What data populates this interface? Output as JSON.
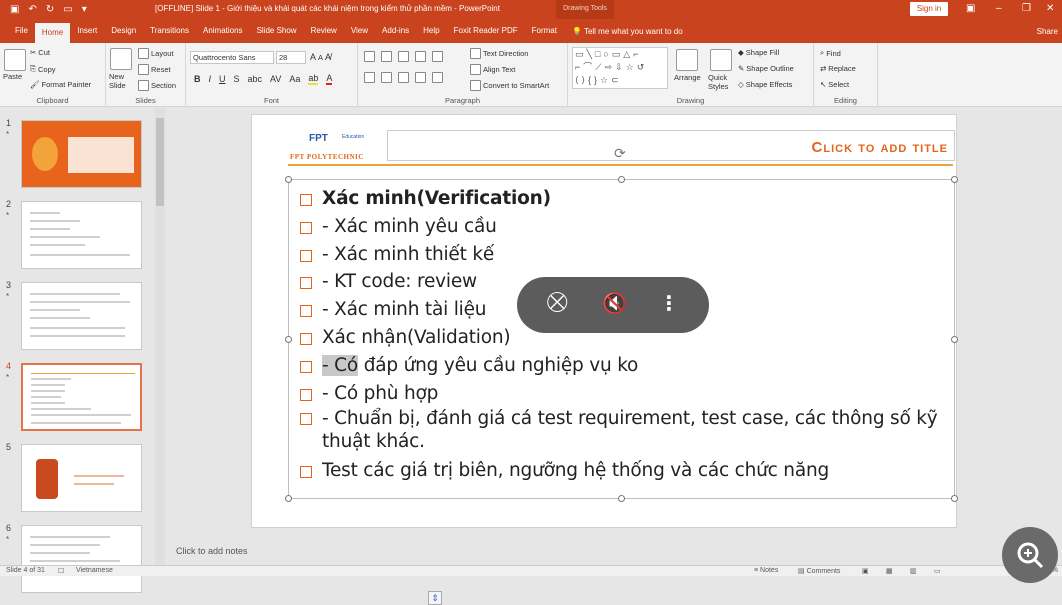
{
  "titlebar": {
    "title": "[OFFLINE] Slide 1 - Giới thiệu và khái quát các khái niệm trong kiểm thử phần mềm - PowerPoint",
    "drawing_tools": "Drawing Tools",
    "sign_in": "Sign in"
  },
  "tabs": [
    "File",
    "Home",
    "Insert",
    "Design",
    "Transitions",
    "Animations",
    "Slide Show",
    "Review",
    "View",
    "Add-ins",
    "Help",
    "Foxit Reader PDF",
    "Format"
  ],
  "tell_me": "Tell me what you want to do",
  "share": "Share",
  "clipboard": {
    "paste": "Paste",
    "cut": "Cut",
    "copy": "Copy",
    "format_painter": "Format Painter",
    "label": "Clipboard"
  },
  "slides_grp": {
    "new_slide": "New Slide",
    "layout": "Layout",
    "reset": "Reset",
    "section": "Section",
    "label": "Slides"
  },
  "font": {
    "name": "Quattrocento Sans",
    "size": "28",
    "label": "Font"
  },
  "paragraph": {
    "text_direction": "Text Direction",
    "align_text": "Align Text",
    "convert": "Convert to SmartArt",
    "label": "Paragraph"
  },
  "drawing": {
    "arrange": "Arrange",
    "quick_styles": "Quick Styles",
    "shape_fill": "Shape Fill",
    "shape_outline": "Shape Outline",
    "shape_effects": "Shape Effects",
    "label": "Drawing"
  },
  "editing": {
    "find": "Find",
    "replace": "Replace",
    "select": "Select",
    "label": "Editing"
  },
  "thumbnails": [
    {
      "num": "1",
      "star": "*"
    },
    {
      "num": "2",
      "star": "*"
    },
    {
      "num": "3",
      "star": "*"
    },
    {
      "num": "4",
      "star": "*"
    },
    {
      "num": "5",
      "star": ""
    },
    {
      "num": "6",
      "star": "*"
    }
  ],
  "slide": {
    "logo_top": "FPT",
    "logo_edu": "Education",
    "logo_sub": "FPT POLYTECHNIC",
    "title_placeholder": "Click to add title",
    "bullets": [
      "Xác minh(Verification)",
      "- Xác minh yêu cầu",
      "- Xác minh thiết kế",
      "- KT code: review",
      "- Xác minh tài liệu",
      "Xác nhận(Validation)",
      "đáp ứng yêu cầu nghiệp vụ ko",
      "- Có phù hợp",
      "- Chuẩn bị, đánh giá cá test requirement, test case, các thông số kỹ thuật khác.",
      "Test các giá trị biên, ngưỡng hệ thống và các chức năng"
    ],
    "bullet7_highlight": "- Có"
  },
  "notes": "Click to add notes",
  "status": {
    "slide": "Slide 4 of 31",
    "language": "Vietnamese",
    "notes": "Notes",
    "comments": "Comments",
    "zoom": "80%"
  }
}
